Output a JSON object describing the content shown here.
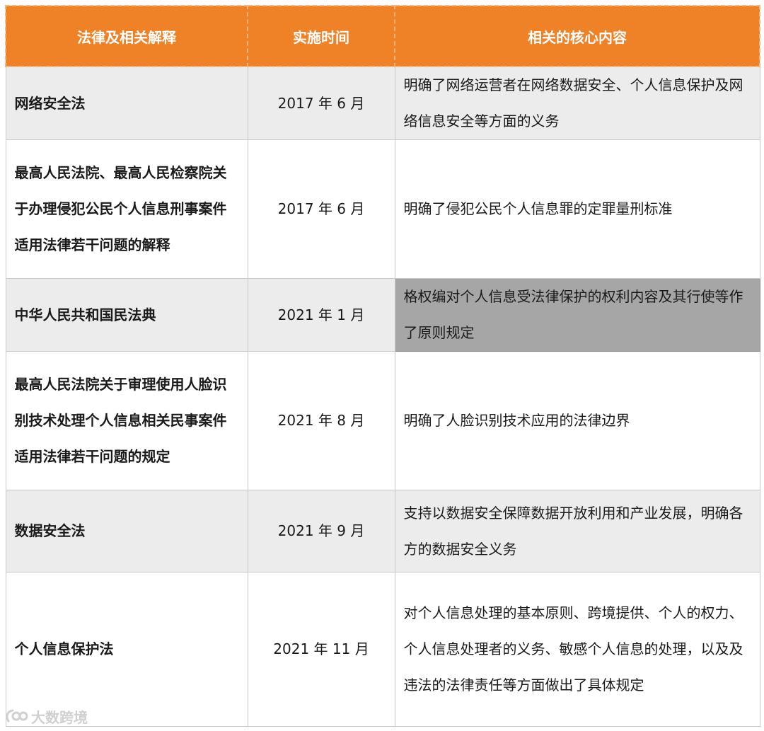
{
  "table": {
    "headers": [
      "法律及相关解释",
      "实施时间",
      "相关的核心内容"
    ],
    "rows": [
      {
        "law": "网络安全法",
        "date": "2017 年 6 月",
        "content": "明确了网络运营者在网络数据安全、个人信息保护及网络信息安全等方面的义务"
      },
      {
        "law": "最高人民法院、最高人民检察院关于办理侵犯公民个人信息刑事案件适用法律若干问题的解释",
        "date": "2017 年 6 月",
        "content": "明确了侵犯公民个人信息罪的定罪量刑标准"
      },
      {
        "law": "中华人民共和国民法典",
        "date": "2021 年 1 月",
        "content": "格权编对个人信息受法律保护的权利内容及其行使等作了原则规定"
      },
      {
        "law": "最高人民法院关于审理使用人脸识别技术处理个人信息相关民事案件适用法律若干问题的规定",
        "date": "2021 年 8 月",
        "content": "明确了人脸识别技术应用的法律边界"
      },
      {
        "law": "数据安全法",
        "date": "2021 年 9 月",
        "content": "支持以数据安全保障数据开放利用和产业发展，明确各方的数据安全义务"
      },
      {
        "law": "个人信息保护法",
        "date": "2021 年 11 月",
        "content": "对个人信息处理的基本原则、跨境提供、个人的权力、个人信息处理者的义务、敏感个人信息的处理，以及及违法的法律责任等方面做出了具体规定"
      }
    ]
  },
  "watermark": {
    "text": "大数跨境",
    "icon": "brand-logo-icon"
  },
  "colors": {
    "header_bg": "#ef8226",
    "row_gray": "#ececec",
    "highlight": "#a6a6a6"
  }
}
